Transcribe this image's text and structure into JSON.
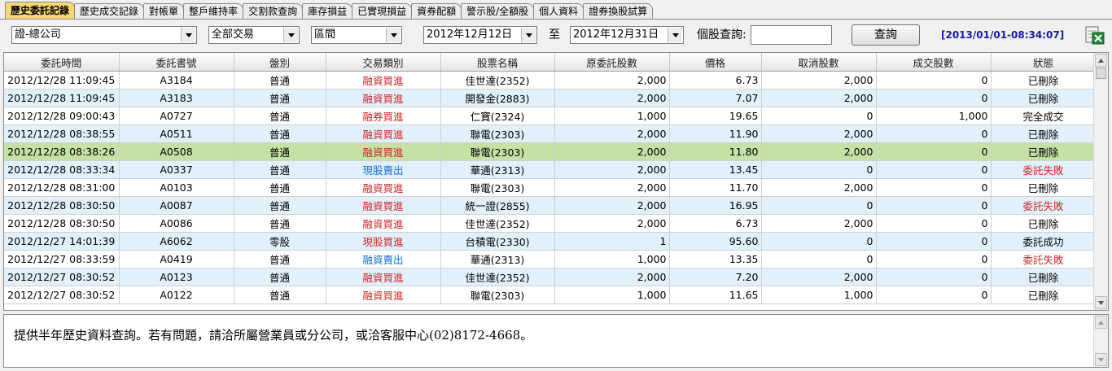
{
  "tabs": [
    "歷史委託記錄",
    "歷史成交記錄",
    "對帳單",
    "整戶維持率",
    "交割款查詢",
    "庫存損益",
    "已實現損益",
    "資券配額",
    "警示股/全額股",
    "個人資料",
    "證券換股試算"
  ],
  "filters": {
    "branch": "證-總公司",
    "trade_type": "全部交易",
    "range": "區間",
    "date_from": "2012年12月12日",
    "to_label": "至",
    "date_to": "2012年12月31日",
    "stock_query_label": "個股查詢:",
    "stock_query_value": "",
    "query_button": "查詢",
    "timestamp": "[2013/01/01-08:34:07]"
  },
  "columns": [
    "委託時間",
    "委託書號",
    "盤別",
    "交易類別",
    "股票名稱",
    "原委託股數",
    "價格",
    "取消股數",
    "成交股數",
    "狀態"
  ],
  "rows": [
    {
      "time": "2012/12/28 11:09:45",
      "no": "A3184",
      "session": "普通",
      "type": "融資買進",
      "type_color": "red",
      "stock": "佳世達(2352)",
      "qty": "2,000",
      "price": "6.73",
      "cancel": "2,000",
      "filled": "0",
      "status": "已刪除",
      "status_color": ""
    },
    {
      "time": "2012/12/28 11:09:45",
      "no": "A3183",
      "session": "普通",
      "type": "融資買進",
      "type_color": "red",
      "stock": "開發金(2883)",
      "qty": "2,000",
      "price": "7.07",
      "cancel": "2,000",
      "filled": "0",
      "status": "已刪除",
      "status_color": ""
    },
    {
      "time": "2012/12/28 09:00:43",
      "no": "A0727",
      "session": "普通",
      "type": "融券買進",
      "type_color": "red",
      "stock": "仁寶(2324)",
      "qty": "1,000",
      "price": "19.65",
      "cancel": "0",
      "filled": "1,000",
      "status": "完全成交",
      "status_color": ""
    },
    {
      "time": "2012/12/28 08:38:55",
      "no": "A0511",
      "session": "普通",
      "type": "融資買進",
      "type_color": "red",
      "stock": "聯電(2303)",
      "qty": "2,000",
      "price": "11.90",
      "cancel": "2,000",
      "filled": "0",
      "status": "已刪除",
      "status_color": ""
    },
    {
      "time": "2012/12/28 08:38:26",
      "no": "A0508",
      "session": "普通",
      "type": "融資買進",
      "type_color": "red",
      "stock": "聯電(2303)",
      "qty": "2,000",
      "price": "11.80",
      "cancel": "2,000",
      "filled": "0",
      "status": "已刪除",
      "status_color": ""
    },
    {
      "time": "2012/12/28 08:33:34",
      "no": "A0337",
      "session": "普通",
      "type": "現股賣出",
      "type_color": "blue",
      "stock": "華通(2313)",
      "qty": "2,000",
      "price": "13.45",
      "cancel": "0",
      "filled": "0",
      "status": "委託失敗",
      "status_color": "red"
    },
    {
      "time": "2012/12/28 08:31:00",
      "no": "A0103",
      "session": "普通",
      "type": "融資買進",
      "type_color": "red",
      "stock": "聯電(2303)",
      "qty": "2,000",
      "price": "11.70",
      "cancel": "2,000",
      "filled": "0",
      "status": "已刪除",
      "status_color": ""
    },
    {
      "time": "2012/12/28 08:30:50",
      "no": "A0087",
      "session": "普通",
      "type": "融資買進",
      "type_color": "red",
      "stock": "統一證(2855)",
      "qty": "2,000",
      "price": "16.95",
      "cancel": "0",
      "filled": "0",
      "status": "委託失敗",
      "status_color": "red"
    },
    {
      "time": "2012/12/28 08:30:50",
      "no": "A0086",
      "session": "普通",
      "type": "融資買進",
      "type_color": "red",
      "stock": "佳世達(2352)",
      "qty": "2,000",
      "price": "6.73",
      "cancel": "2,000",
      "filled": "0",
      "status": "已刪除",
      "status_color": ""
    },
    {
      "time": "2012/12/27 14:01:39",
      "no": "A6062",
      "session": "零股",
      "type": "現股買進",
      "type_color": "red",
      "stock": "台積電(2330)",
      "qty": "1",
      "price": "95.60",
      "cancel": "0",
      "filled": "0",
      "status": "委託成功",
      "status_color": ""
    },
    {
      "time": "2012/12/27 08:33:59",
      "no": "A0419",
      "session": "普通",
      "type": "融資賣出",
      "type_color": "blue",
      "stock": "華通(2313)",
      "qty": "1,000",
      "price": "13.35",
      "cancel": "0",
      "filled": "0",
      "status": "委託失敗",
      "status_color": "red"
    },
    {
      "time": "2012/12/27 08:30:52",
      "no": "A0123",
      "session": "普通",
      "type": "融資買進",
      "type_color": "red",
      "stock": "佳世達(2352)",
      "qty": "2,000",
      "price": "7.20",
      "cancel": "2,000",
      "filled": "0",
      "status": "已刪除",
      "status_color": ""
    },
    {
      "time": "2012/12/27 08:30:52",
      "no": "A0122",
      "session": "普通",
      "type": "融資買進",
      "type_color": "red",
      "stock": "聯電(2303)",
      "qty": "1,000",
      "price": "11.65",
      "cancel": "1,000",
      "filled": "0",
      "status": "已刪除",
      "status_color": ""
    }
  ],
  "selected_row": 4,
  "footer_message": "提供半年歷史資料查詢。若有問題，請洽所屬營業員或分公司，或洽客服中心(02)8172-4668。",
  "icons": {
    "export": "excel-export-icon"
  }
}
